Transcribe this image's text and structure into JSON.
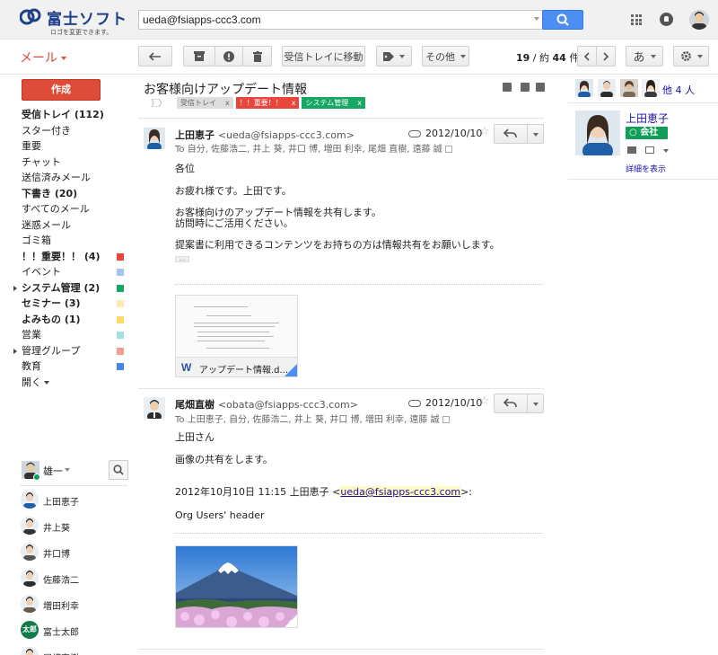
{
  "header": {
    "logo_text": "富士ソフト",
    "logo_sub": "ロゴを変更できます。",
    "search_value": "ueda@fsiapps-ccc3.com"
  },
  "toolbar": {
    "mail_label": "メール",
    "move_inbox": "受信トレイに移動",
    "more": "その他",
    "page_count_range": "19",
    "page_count_sep": " / 約 ",
    "page_count_total": "44",
    "page_count_unit": " 件",
    "input_mode": "あ"
  },
  "sidebar": {
    "compose": "作成",
    "items": [
      {
        "label": "受信トレイ (112)",
        "bold": true
      },
      {
        "label": "スター付き"
      },
      {
        "label": "重要"
      },
      {
        "label": "チャット"
      },
      {
        "label": "送信済みメール"
      },
      {
        "label": "下書き (20)",
        "bold": true
      },
      {
        "label": "すべてのメール"
      },
      {
        "label": "迷惑メール"
      },
      {
        "label": "ゴミ箱"
      },
      {
        "label": "！！重要！！ (4)",
        "bold": true,
        "color": "#e8453c"
      },
      {
        "label": "イベント",
        "color": "#a4c2f4"
      },
      {
        "label": "システム管理 (2)",
        "bold": true,
        "color": "#16a765",
        "expand": true
      },
      {
        "label": "セミナー (3)",
        "bold": true,
        "color": "#fce8b3"
      },
      {
        "label": "よみもの (1)",
        "bold": true,
        "color": "#ffd966"
      },
      {
        "label": "営業",
        "color": "#9fe1e7"
      },
      {
        "label": "管理グループ",
        "color": "#efa093",
        "expand": true
      },
      {
        "label": "教育",
        "color": "#4a86e8"
      },
      {
        "label": "開く",
        "more": true
      }
    ]
  },
  "chat": {
    "me": "雄一",
    "contacts": [
      {
        "name": "上田恵子"
      },
      {
        "name": "井上葵"
      },
      {
        "name": "井口博"
      },
      {
        "name": "佐藤浩二"
      },
      {
        "name": "増田利幸"
      },
      {
        "name": "富士太郎",
        "initials": "太郎"
      },
      {
        "name": "尾畑直樹"
      }
    ]
  },
  "thread": {
    "subject": "お客様向けアップデート情報",
    "labels": [
      {
        "text": "受信トレイ",
        "color": "#dddddd",
        "text_color": "#666666"
      },
      {
        "text": "！！重要！！",
        "color": "#e8453c",
        "text_color": "#ffffff"
      },
      {
        "text": "システム管理",
        "color": "#16a765",
        "text_color": "#ffffff"
      }
    ],
    "label_close": "x",
    "messages": [
      {
        "sender": "上田恵子",
        "email": "<ueda@fsiapps-ccc3.com>",
        "date": "2012/10/10",
        "to": "To 自分, 佐藤浩二, 井上 葵, 井口 博, 増田 利幸, 尾畑 直樹, 遠藤 誠",
        "body": [
          "各位",
          "お疲れ様です。上田です。",
          "お客様向けのアップデート情報を共有します。",
          "訪問時にご活用ください。",
          "提案書に利用できるコンテンツをお持ちの方は情報共有をお願いします。"
        ],
        "attachment_name": "アップデート情報.d...",
        "attachment_icon": "W"
      },
      {
        "sender": "尾畑直樹",
        "email": "<obata@fsiapps-ccc3.com>",
        "date": "2012/10/10",
        "to": "To 上田恵子, 自分, 佐藤浩二, 井上 葵, 井口 博, 増田 利幸, 遠藤 誠",
        "body": [
          "上田さん",
          "画像の共有をします。"
        ],
        "quote_prefix": "2012年10月10日 11:15 上田恵子 <",
        "quote_email": "ueda@fsiapps-ccc3.com",
        "quote_suffix": ">:",
        "quote_line": "Org Users' header"
      }
    ]
  },
  "right_panel": {
    "others": "他 4 人",
    "contact_name": "上田恵子",
    "badge": "○ 会社",
    "detail_link": "詳細を表示"
  },
  "colors": {
    "accent_red": "#dd4b39",
    "accent_blue": "#4d8ef5",
    "link_blue": "#1a0dab",
    "online_green": "#0f9d58"
  }
}
